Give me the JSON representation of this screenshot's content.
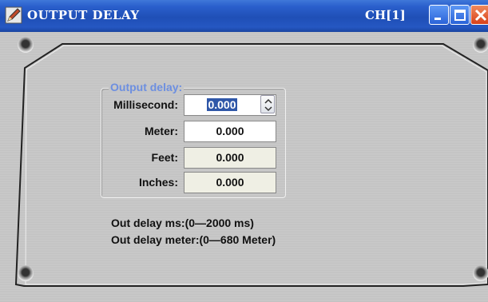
{
  "window": {
    "title": "OUTPUT DELAY",
    "channel": "CH[1]",
    "icon": "pencil-icon"
  },
  "group": {
    "legend": "Output delay:"
  },
  "fields": {
    "millisecond": {
      "label": "Millisecond:",
      "value": "0.000"
    },
    "meter": {
      "label": "Meter:",
      "value": "0.000"
    },
    "feet": {
      "label": "Feet:",
      "value": "0.000"
    },
    "inches": {
      "label": "Inches:",
      "value": "0.000"
    }
  },
  "notes": {
    "ms_range": "Out delay ms:(0—2000 ms)",
    "meter_range": "Out delay meter:(0—680 Meter)"
  },
  "colors": {
    "titlebar": "#2a5fcc",
    "legend": "#6d8fe0",
    "selection": "#2f57a8"
  }
}
